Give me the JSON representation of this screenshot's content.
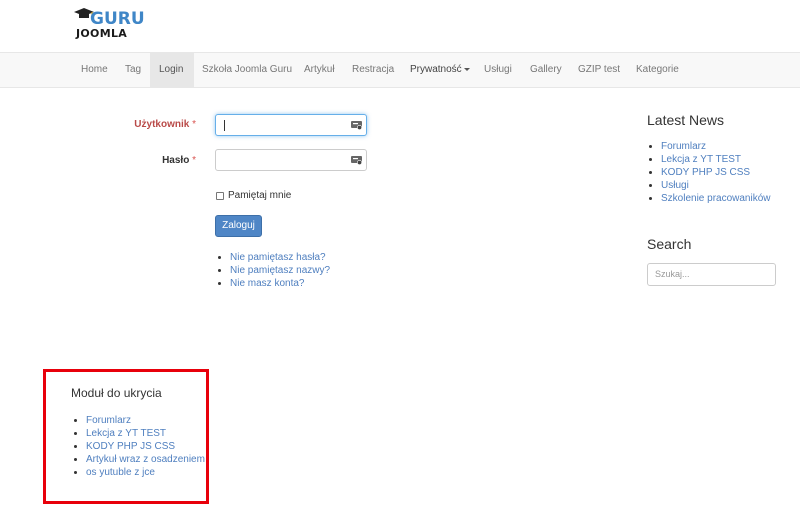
{
  "logo": {
    "text_top": "GURU",
    "text_bottom": "JOOMLA",
    "icon": "graduation-cap-icon"
  },
  "nav": {
    "items": [
      {
        "label": "Home"
      },
      {
        "label": "Tag"
      },
      {
        "label": "Login"
      },
      {
        "label": "Szkoła Joomla Guru"
      },
      {
        "label": "Artykuł"
      },
      {
        "label": "Restracja"
      },
      {
        "label": "Prywatność"
      },
      {
        "label": "Usługi"
      },
      {
        "label": "Gallery"
      },
      {
        "label": "GZIP test"
      },
      {
        "label": "Kategorie"
      }
    ]
  },
  "login": {
    "username_label": "Użytkownik",
    "password_label": "Hasło",
    "required_mark": "*",
    "username_value": "",
    "password_value": "",
    "remember_label": "Pamiętaj mnie",
    "submit_label": "Zaloguj",
    "links": [
      "Nie pamiętasz hasła?",
      "Nie pamiętasz nazwy?",
      "Nie masz konta?"
    ]
  },
  "sidebar": {
    "latest_news_title": "Latest News",
    "latest_news": [
      "Forumlarz",
      "Lekcja z YT TEST",
      "KODY PHP JS CSS",
      "Usługi",
      "Szkolenie pracowaników"
    ],
    "search_title": "Search",
    "search_placeholder": "Szukaj..."
  },
  "hidden_module": {
    "title": "Moduł do ukrycia",
    "items": [
      "Forumlarz",
      "Lekcja z YT TEST",
      "KODY PHP JS CSS",
      "Artykuł wraz z osadzeniem",
      "os yutuble z jce"
    ],
    "highlight_color": "#e8000b"
  },
  "colors": {
    "accent": "#4f86c6",
    "link": "#4f7fbf",
    "error_label": "#b94a48"
  }
}
